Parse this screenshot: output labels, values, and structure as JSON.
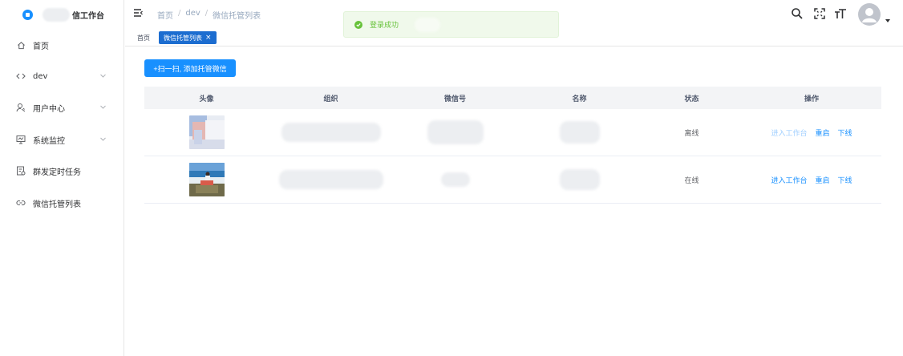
{
  "app": {
    "title": "信工作台"
  },
  "sidebar": {
    "items": [
      {
        "label": "首页",
        "icon": "home-icon",
        "expandable": false
      },
      {
        "label": "dev",
        "icon": "code-icon",
        "expandable": true
      },
      {
        "label": "用户中心",
        "icon": "user-icon",
        "expandable": true
      },
      {
        "label": "系统监控",
        "icon": "monitor-icon",
        "expandable": true
      },
      {
        "label": "群发定时任务",
        "icon": "task-icon",
        "expandable": false
      },
      {
        "label": "微信托管列表",
        "icon": "link-icon",
        "expandable": false
      }
    ]
  },
  "breadcrumb": [
    "首页",
    "dev",
    "微信托管列表"
  ],
  "toast": {
    "text": "登录成功",
    "type": "success",
    "color": "#67c23a"
  },
  "tags": {
    "home": "首页",
    "active": "微信托管列表",
    "close": "×"
  },
  "toolbar": {
    "add_label": "+扫一扫, 添加托管微信"
  },
  "table": {
    "headers": [
      "头像",
      "组织",
      "微信号",
      "名称",
      "状态",
      "操作"
    ],
    "rows": [
      {
        "status": "离线",
        "actions": [
          "进入工作台",
          "重启",
          "下线"
        ],
        "enter_disabled": true
      },
      {
        "status": "在线",
        "actions": [
          "进入工作台",
          "重启",
          "下线"
        ],
        "enter_disabled": false
      }
    ]
  },
  "colors": {
    "primary": "#1890ff",
    "tag_active": "#1c6dd0",
    "success": "#67c23a",
    "link_disabled": "#a0cfff"
  }
}
